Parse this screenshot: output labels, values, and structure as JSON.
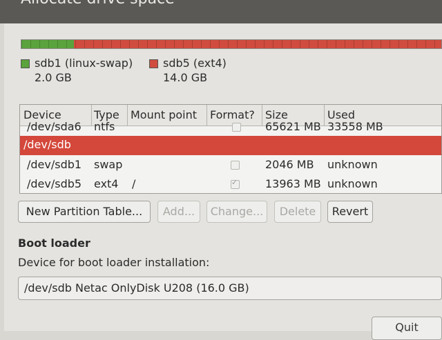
{
  "window": {
    "title": "Allocate drive space"
  },
  "partition_bar": {
    "segments": [
      {
        "name": "sdb1 (linux-swap)",
        "size": "2.0 GB",
        "color": "#5aa33d",
        "fraction": 0.125
      },
      {
        "name": "sdb5 (ext4)",
        "size": "14.0 GB",
        "color": "#d04c3e",
        "fraction": 0.875
      }
    ]
  },
  "table": {
    "headers": [
      "Device",
      "Type",
      "Mount point",
      "Format?",
      "Size",
      "Used"
    ],
    "rows": [
      {
        "device": "/dev/sda6",
        "type": "ntfs",
        "mount": "",
        "format": false,
        "size": "65621 MB",
        "used": "33558 MB"
      },
      {
        "device": "/dev/sdb",
        "type": "",
        "mount": "",
        "format": null,
        "size": "",
        "used": ""
      },
      {
        "device": "/dev/sdb1",
        "type": "swap",
        "mount": "",
        "format": false,
        "size": "2046 MB",
        "used": "unknown"
      },
      {
        "device": "/dev/sdb5",
        "type": "ext4",
        "mount": "/",
        "format": true,
        "size": "13963 MB",
        "used": "unknown"
      }
    ],
    "selected_row": 1
  },
  "buttons": {
    "new_partition_table": "New Partition Table...",
    "add": "Add...",
    "change": "Change...",
    "delete": "Delete",
    "revert": "Revert",
    "quit": "Quit"
  },
  "boot_loader": {
    "title": "Boot loader",
    "label": "Device for boot loader installation:",
    "selected": "/dev/sdb Netac OnlyDisk U208 (16.0 GB)"
  }
}
